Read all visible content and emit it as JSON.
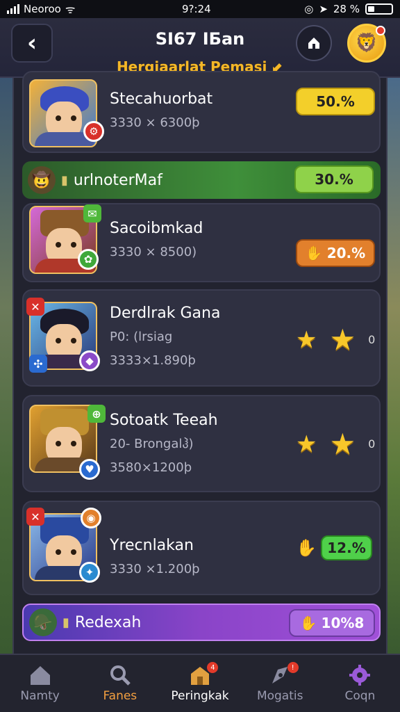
{
  "status": {
    "carrier": "Neoroo",
    "time": "9?:24",
    "battery": "28 %",
    "battery_level": 0.28
  },
  "header": {
    "title": "SI67 IБan",
    "subtitle": "Hergjaarlat Pemasi ⬋"
  },
  "items": [
    {
      "name": "Stecahuorbat",
      "meta": "3330 × 6300þ",
      "percent": "50.%",
      "percent_color": "#f3cf2a"
    },
    {
      "banner": true,
      "label": "urlnoterMaf",
      "percent": "30.%",
      "color": "#3f8f3a",
      "percent_color": "#8fd24a"
    },
    {
      "name": "Sacoibmkad",
      "meta": "3330 × 8500)",
      "percent": "20.%",
      "percent_color": "#e2802c"
    },
    {
      "name": "Derdlrak Gana",
      "meta": "P0: (lrsiag",
      "meta2": "3333×1.890þ",
      "stars_count": "0"
    },
    {
      "name": "Sotoatk Teeah",
      "meta": "20- Brongalჰ)",
      "meta2": "3580×1200þ",
      "stars_count": "0"
    },
    {
      "name": "Yrecnlakan",
      "meta": "3330 ×1.200þ",
      "percent": "12.%",
      "percent_color": "#4fd04a"
    },
    {
      "banner": true,
      "label": "Redexah",
      "percent": "10%8",
      "color": "#8a44c8",
      "percent_color": "#a86ae0"
    }
  ],
  "nav": [
    {
      "label": "Namty",
      "icon": "home-icon"
    },
    {
      "label": "Fanes",
      "icon": "search-icon"
    },
    {
      "label": "Peringkak",
      "icon": "leaderboard-icon",
      "badge": "4"
    },
    {
      "label": "Mogatis",
      "icon": "missions-icon",
      "badge": "!"
    },
    {
      "label": "Coqn",
      "icon": "gear-icon"
    }
  ],
  "colors": {
    "accent": "#f4b728",
    "header_bg": "#2b2c3e",
    "card_bg": "#2f3041",
    "active_nav": "#f4a040"
  }
}
